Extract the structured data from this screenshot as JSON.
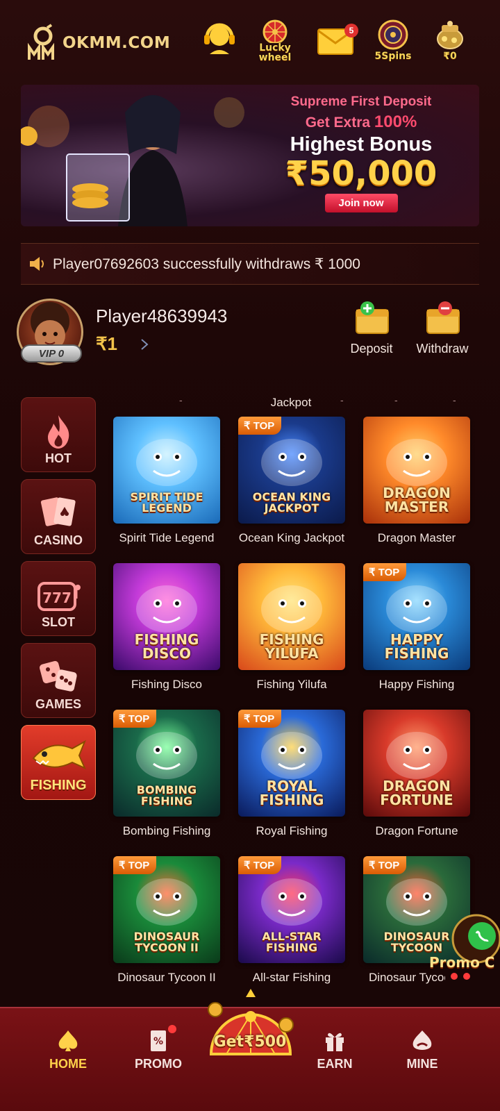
{
  "header": {
    "logo_text": "OKMM.COM",
    "buttons": [
      {
        "name": "support",
        "label": ""
      },
      {
        "name": "lucky-wheel",
        "label": "Lucky wheel",
        "label_line1": "Lucky",
        "label_line2": "wheel"
      },
      {
        "name": "messages",
        "label": "",
        "badge": "5"
      },
      {
        "name": "spins",
        "label": "5Spins"
      },
      {
        "name": "coin-box",
        "label": "₹0"
      }
    ]
  },
  "banner": {
    "line1": "Supreme First Deposit",
    "line2_prefix": "Get Extra ",
    "line2_highlight": "100%",
    "line3": "Highest Bonus",
    "amount": "₹50,000",
    "cta": "Join now"
  },
  "marquee": {
    "text": "Player07692603 successfully withdraws ₹ 1000"
  },
  "user": {
    "name": "Player48639943",
    "balance": "₹1",
    "vip": "VIP 0",
    "deposit_label": "Deposit",
    "withdraw_label": "Withdraw"
  },
  "side_nav": [
    {
      "key": "hot",
      "label": "HOT"
    },
    {
      "key": "casino",
      "label": "CASINO"
    },
    {
      "key": "slot",
      "label": "SLOT"
    },
    {
      "key": "games",
      "label": "GAMES"
    },
    {
      "key": "fishing",
      "label": "FISHING",
      "active": true
    }
  ],
  "grid_header": "Jackpot",
  "games": [
    {
      "name": "Spirit Tide Legend",
      "art": "SPIRIT TIDE LEGEND",
      "top": false
    },
    {
      "name": "Ocean King Jackpot",
      "art": "OCEAN KING JACKPOT",
      "top": true
    },
    {
      "name": "Dragon Master",
      "art": "DRAGON MASTER",
      "top": false
    },
    {
      "name": "Fishing Disco",
      "art": "FISHING DISCO",
      "top": false
    },
    {
      "name": "Fishing Yilufa",
      "art": "FISHING YILUFA",
      "top": false
    },
    {
      "name": "Happy Fishing",
      "art": "HAPPY FISHING",
      "top": true
    },
    {
      "name": "Bombing Fishing",
      "art": "BOMBING FISHING",
      "top": true
    },
    {
      "name": "Royal Fishing",
      "art": "ROYAL FISHING",
      "top": true
    },
    {
      "name": "Dragon Fortune",
      "art": "DRAGON FORTUNE",
      "top": false
    },
    {
      "name": "Dinosaur Tycoon II",
      "art": "DINOSAUR TYCOON II",
      "top": true
    },
    {
      "name": "All-star Fishing",
      "art": "ALL-STAR FISHING",
      "top": true
    },
    {
      "name": "Dinosaur Tycoon",
      "art": "DINOSAUR TYCOON",
      "top": true
    }
  ],
  "top_tag": "₹ TOP",
  "float_promo": "Promo C",
  "bottom_nav": [
    {
      "key": "home",
      "label": "HOME",
      "active": true
    },
    {
      "key": "promo",
      "label": "PROMO"
    },
    {
      "key": "earn",
      "label": "EARN"
    },
    {
      "key": "mine",
      "label": "MINE"
    }
  ],
  "get_bonus": "Get₹500",
  "colors": {
    "accent_gold": "#ffd24a",
    "bg_dark": "#1e0707",
    "nav_red": "#7a1216",
    "active_side": "#e23c2a"
  }
}
